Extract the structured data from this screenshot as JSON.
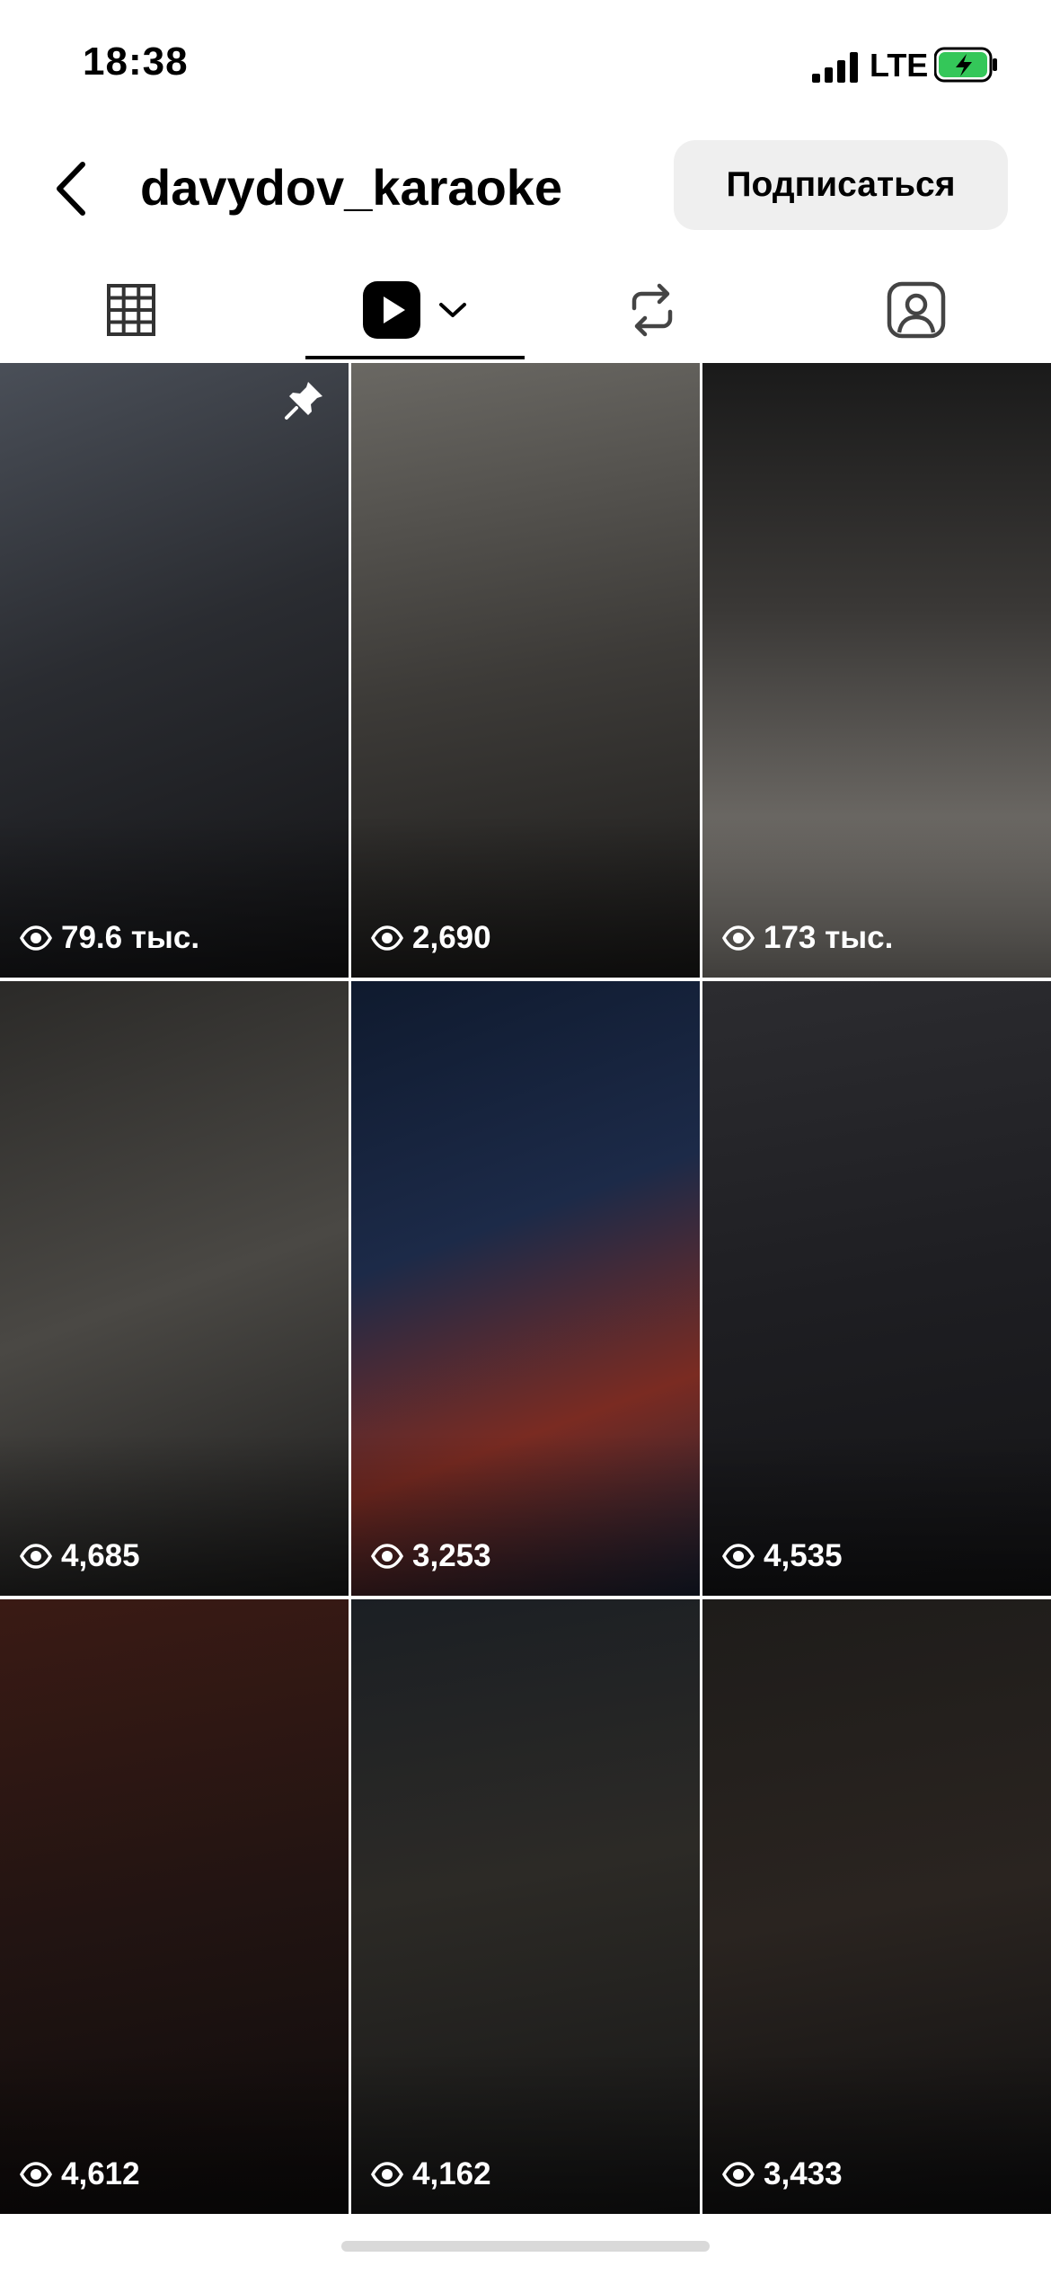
{
  "status_bar": {
    "time": "18:38",
    "network": "LTE"
  },
  "header": {
    "username": "davydov_karaoke",
    "follow_label": "Подписаться"
  },
  "tabs": [
    {
      "name": "grid",
      "icon": "grid-icon"
    },
    {
      "name": "reels",
      "icon": "reels-icon",
      "active": true
    },
    {
      "name": "reposts",
      "icon": "repost-icon"
    },
    {
      "name": "tagged",
      "icon": "tagged-icon"
    }
  ],
  "reels": [
    {
      "views": "79.6 тыс.",
      "pinned": true,
      "bg": "linear-gradient(160deg,#4a4f58 0%,#2a2c31 45%,#141416 100%)"
    },
    {
      "views": "2,690",
      "bg": "linear-gradient(170deg,#6a6863 0%,#3d3b38 50%,#1c1b1a 100%)"
    },
    {
      "views": "173 тыс.",
      "bg": "linear-gradient(180deg,#1a1a1a 0%,#3a3836 40%,#8e8a84 100%)"
    },
    {
      "views": "4,685",
      "bg": "linear-gradient(160deg,#2b2a28 0%,#4a4844 50%,#1b1b1b 100%)"
    },
    {
      "views": "3,253",
      "bg": "linear-gradient(160deg,#0f1a2e 0%,#1c2a48 40%,#7a2b22 70%,#1a2236 100%)"
    },
    {
      "views": "4,535",
      "bg": "linear-gradient(170deg,#2c2c30 0%,#1e1e22 50%,#141416 100%)"
    },
    {
      "views": "4,612",
      "bg": "linear-gradient(170deg,#3a1a14 0%,#221412 50%,#0e0c0c 100%)"
    },
    {
      "views": "4,162",
      "bg": "linear-gradient(170deg,#1b1f24 0%,#2c2a26 45%,#161616 100%)"
    },
    {
      "views": "3,433",
      "bg": "linear-gradient(170deg,#1e1c1a 0%,#2a2420 50%,#0f0f10 100%)"
    }
  ],
  "colors": {
    "accent": "#000000",
    "button_bg": "#efefef",
    "battery": "#34c759"
  }
}
